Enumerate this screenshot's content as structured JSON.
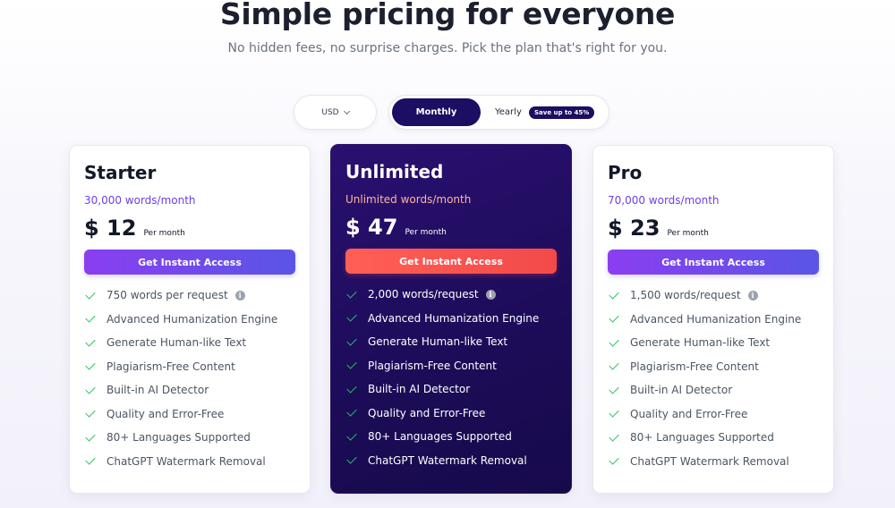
{
  "header": {
    "title": "Simple pricing for everyone",
    "subtitle": "No hidden fees, no surprise charges. Pick the plan that's right for you."
  },
  "controls": {
    "currency": "USD",
    "monthly_label": "Monthly",
    "yearly_label": "Yearly",
    "save_badge": "Save up to 45%",
    "selected_period": "Monthly"
  },
  "plans": [
    {
      "name": "Starter",
      "words": "30,000 words/month",
      "price": "$ 12",
      "per": "Per month",
      "cta": "Get Instant Access",
      "features": [
        "750 words per request",
        "Advanced Humanization Engine",
        "Generate Human-like Text",
        "Plagiarism-Free Content",
        "Built-in AI Detector",
        "Quality and Error-Free",
        "80+ Languages Supported",
        "ChatGPT Watermark Removal"
      ]
    },
    {
      "name": "Unlimited",
      "words": "Unlimited words/month",
      "price": "$ 47",
      "per": "Per month",
      "cta": "Get Instant Access",
      "features": [
        "2,000 words/request",
        "Advanced Humanization Engine",
        "Generate Human-like Text",
        "Plagiarism-Free Content",
        "Built-in AI Detector",
        "Quality and Error-Free",
        "80+ Languages Supported",
        "ChatGPT Watermark Removal"
      ]
    },
    {
      "name": "Pro",
      "words": "70,000 words/month",
      "price": "$ 23",
      "per": "Per month",
      "cta": "Get Instant Access",
      "features": [
        "1,500 words/request",
        "Advanced Humanization Engine",
        "Generate Human-like Text",
        "Plagiarism-Free Content",
        "Built-in AI Detector",
        "Quality and Error-Free",
        "80+ Languages Supported",
        "ChatGPT Watermark Removal"
      ]
    }
  ],
  "icons": {
    "feature": "check-icon",
    "info": "info-icon",
    "dropdown": "chevron-down-icon"
  },
  "colors": {
    "brand_dark": "#1c0e63",
    "accent_purple": "#6d3fe6",
    "cta_red": "#ff5f55",
    "check_green": "#22c55e"
  }
}
